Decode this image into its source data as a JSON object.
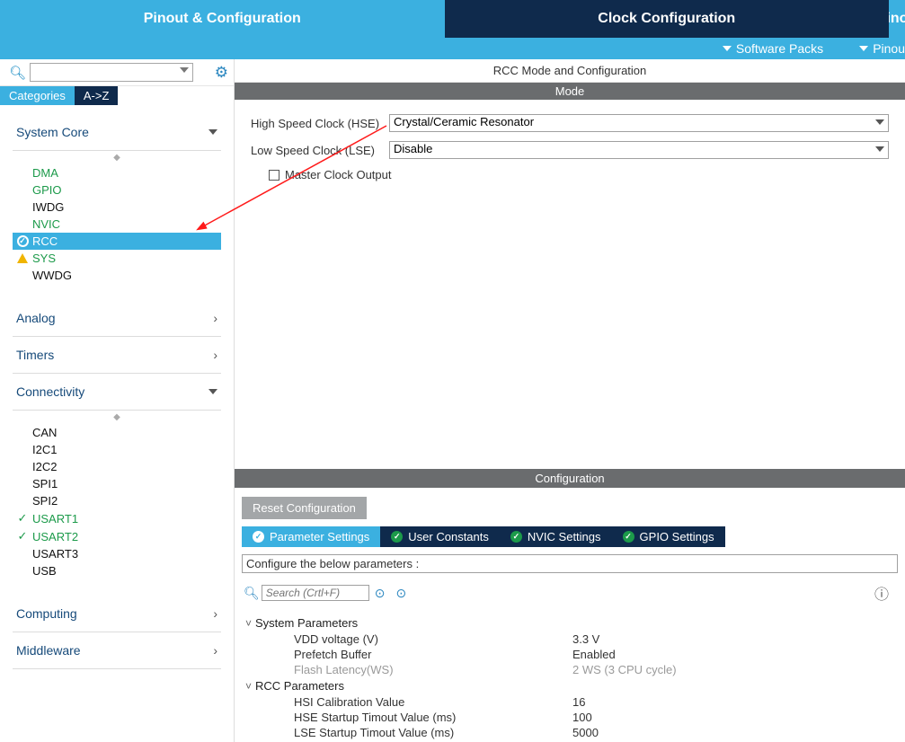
{
  "topTabs": {
    "pinout": "Pinout & Configuration",
    "clock": "Clock Configuration",
    "proj": "Pinou"
  },
  "subBar": {
    "software": "Software Packs",
    "pinout": "Pinou"
  },
  "sidebar": {
    "catTab": "Categories",
    "azTab": "A->Z",
    "groups": {
      "system": {
        "title": "System Core",
        "items": [
          {
            "label": "DMA",
            "cls": "green"
          },
          {
            "label": "GPIO",
            "cls": "green"
          },
          {
            "label": "IWDG",
            "cls": "black"
          },
          {
            "label": "NVIC",
            "cls": "green"
          },
          {
            "label": "RCC",
            "cls": "sel",
            "icon": "check"
          },
          {
            "label": "SYS",
            "cls": "green",
            "icon": "warn"
          },
          {
            "label": "WWDG",
            "cls": "black"
          }
        ]
      },
      "analog": {
        "title": "Analog"
      },
      "timers": {
        "title": "Timers"
      },
      "connectivity": {
        "title": "Connectivity",
        "items": [
          {
            "label": "CAN",
            "cls": "black"
          },
          {
            "label": "I2C1",
            "cls": "black"
          },
          {
            "label": "I2C2",
            "cls": "black"
          },
          {
            "label": "SPI1",
            "cls": "black"
          },
          {
            "label": "SPI2",
            "cls": "black"
          },
          {
            "label": "USART1",
            "cls": "green",
            "icon": "check-plain"
          },
          {
            "label": "USART2",
            "cls": "green",
            "icon": "check-plain"
          },
          {
            "label": "USART3",
            "cls": "black"
          },
          {
            "label": "USB",
            "cls": "black"
          }
        ]
      },
      "computing": {
        "title": "Computing"
      },
      "middleware": {
        "title": "Middleware"
      }
    }
  },
  "rcc": {
    "title": "RCC Mode and Configuration",
    "modeTitle": "Mode",
    "hseLabel": "High Speed Clock (HSE)",
    "hseVal": "Crystal/Ceramic Resonator",
    "lseLabel": "Low Speed Clock (LSE)",
    "lseVal": "Disable",
    "mco": "Master Clock Output"
  },
  "config": {
    "title": "Configuration",
    "reset": "Reset Configuration",
    "tabs": {
      "param": "Parameter Settings",
      "user": "User Constants",
      "nvic": "NVIC Settings",
      "gpio": "GPIO Settings"
    },
    "hint": "Configure the below parameters :",
    "searchPh": "Search (Crtl+F)",
    "sys": {
      "title": "System Parameters",
      "vdd": {
        "n": "VDD voltage (V)",
        "v": "3.3 V"
      },
      "pref": {
        "n": "Prefetch Buffer",
        "v": "Enabled"
      },
      "flash": {
        "n": "Flash Latency(WS)",
        "v": "2 WS (3 CPU cycle)"
      }
    },
    "rccp": {
      "title": "RCC Parameters",
      "hsi": {
        "n": "HSI Calibration Value",
        "v": "16"
      },
      "hse": {
        "n": "HSE Startup Timout Value (ms)",
        "v": "100"
      },
      "lse": {
        "n": "LSE Startup Timout Value (ms)",
        "v": "5000"
      }
    }
  }
}
